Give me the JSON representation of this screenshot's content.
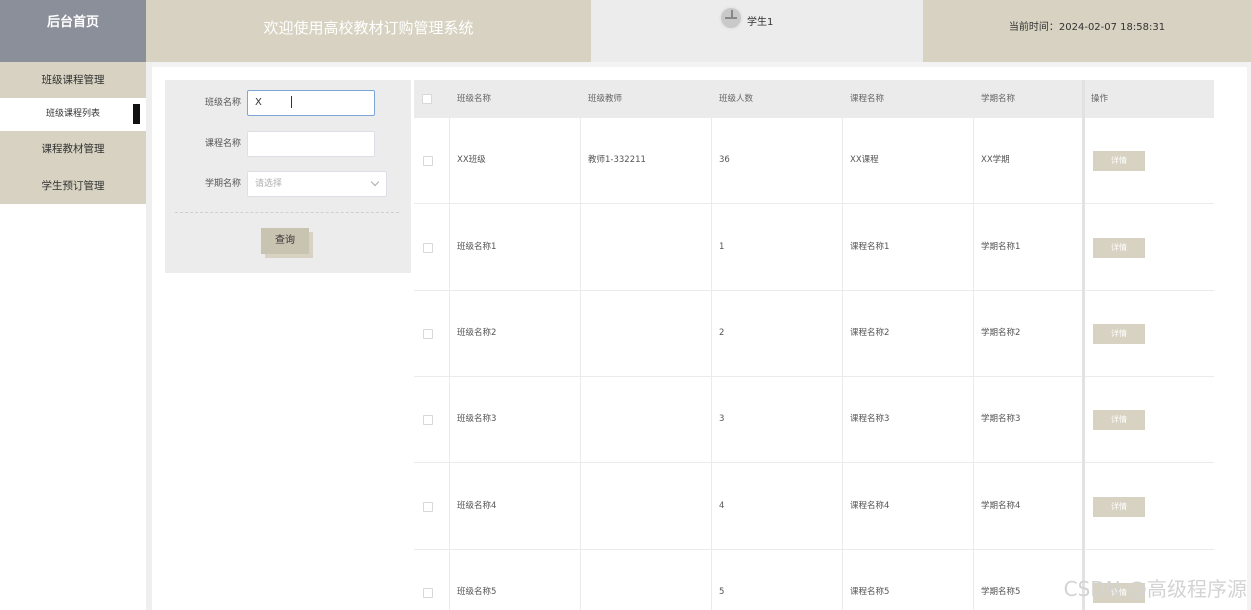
{
  "header": {
    "brand": "后台首页",
    "system_title": "欢迎使用高校教材订购管理系统",
    "username": "学生1",
    "time_label": "当前时间：",
    "time_value": "2024-02-07 18:58:31"
  },
  "sidebar": {
    "items": [
      {
        "label": "班级课程管理"
      },
      {
        "label": "班级课程列表"
      },
      {
        "label": "课程教材管理"
      },
      {
        "label": "学生预订管理"
      }
    ]
  },
  "search": {
    "class_name_label": "班级名称",
    "class_name_value": "X",
    "course_name_label": "课程名称",
    "course_name_value": "",
    "term_label": "学期名称",
    "term_placeholder": "请选择",
    "query_label": "查询"
  },
  "table": {
    "headers": [
      "班级名称",
      "班级教师",
      "班级人数",
      "课程名称",
      "学期名称",
      "操作"
    ],
    "rows": [
      {
        "class_name": "XX班级",
        "teacher": "教师1-332211",
        "count": "36",
        "course": "XX课程",
        "term": "XX学期",
        "action": "详情"
      },
      {
        "class_name": "班级名称1",
        "teacher": "",
        "count": "1",
        "course": "课程名称1",
        "term": "学期名称1",
        "action": "详情"
      },
      {
        "class_name": "班级名称2",
        "teacher": "",
        "count": "2",
        "course": "课程名称2",
        "term": "学期名称2",
        "action": "详情"
      },
      {
        "class_name": "班级名称3",
        "teacher": "",
        "count": "3",
        "course": "课程名称3",
        "term": "学期名称3",
        "action": "详情"
      },
      {
        "class_name": "班级名称4",
        "teacher": "",
        "count": "4",
        "course": "课程名称4",
        "term": "学期名称4",
        "action": "详情"
      },
      {
        "class_name": "班级名称5",
        "teacher": "",
        "count": "5",
        "course": "课程名称5",
        "term": "学期名称5",
        "action": "详情"
      }
    ]
  },
  "watermark": "CSDN @高级程序源",
  "colors": {
    "brand_bg": "#8a8f99",
    "accent_beige": "#d7d2c1",
    "header_user_bg": "#ececec"
  }
}
